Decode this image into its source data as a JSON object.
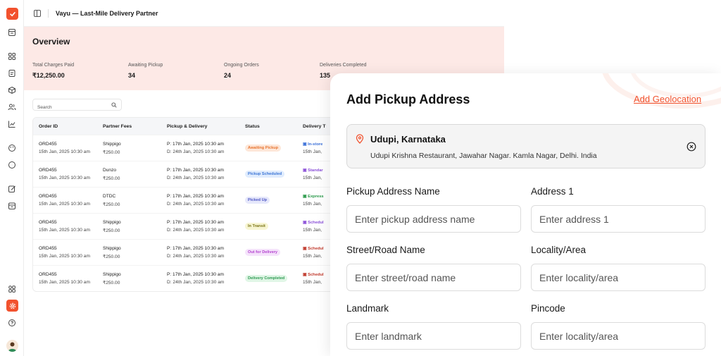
{
  "app": {
    "title": "Vayu — Last-Mile Delivery Partner"
  },
  "sidebar": {
    "icons": [
      "checklist-logo-icon",
      "orders-icon",
      "grid-icon",
      "document-icon",
      "box-icon",
      "users-icon",
      "chart-icon",
      "palette-icon",
      "chat-icon",
      "edit-icon",
      "archive-icon",
      "apps-icon",
      "settings-icon",
      "help-icon",
      "avatar"
    ]
  },
  "overview": {
    "title": "Overview",
    "stats": [
      {
        "label": "Total Charges Paid",
        "value": "₹12,250.00"
      },
      {
        "label": "Awaiting Pickup",
        "value": "34"
      },
      {
        "label": "Ongoing Orders",
        "value": "24"
      },
      {
        "label": "Deliveries Completed",
        "value": "135"
      }
    ]
  },
  "search": {
    "placeholder": "Search"
  },
  "table": {
    "headers": [
      "Order ID",
      "Partner Fees",
      "Pickup & Delivery",
      "Status",
      "Delivery T"
    ],
    "rows": [
      {
        "order_id": "ORD455",
        "order_date": "15th Jan, 2025 10:30 am",
        "partner": "Shippigo",
        "fee": "₹250.00",
        "pickup": "P: 17th Jan, 2025 10:30 am",
        "delivery": "D: 24th Jan, 2025 10:30 am",
        "status": "Awaiting Pickup",
        "status_bg": "#fde7d9",
        "status_fg": "#e8742f",
        "dtype": "In-store",
        "dtype_color": "#3a6fd8",
        "dtype_date": "15th Jan,"
      },
      {
        "order_id": "ORD455",
        "order_date": "15th Jan, 2025 10:30 am",
        "partner": "Dunzo",
        "fee": "₹250.00",
        "pickup": "P: 17th Jan, 2025 10:30 am",
        "delivery": "D: 24th Jan, 2025 10:30 am",
        "status": "Pickup Scheduled",
        "status_bg": "#e0ecfd",
        "status_fg": "#3a74d6",
        "dtype": "Standar",
        "dtype_color": "#8a4fd8",
        "dtype_date": "15th Jan,"
      },
      {
        "order_id": "ORD455",
        "order_date": "15th Jan, 2025 10:30 am",
        "partner": "DTDC",
        "fee": "₹250.00",
        "pickup": "P: 17th Jan, 2025 10:30 am",
        "delivery": "D: 24th Jan, 2025 10:30 am",
        "status": "Picked Up",
        "status_bg": "#e6e8fb",
        "status_fg": "#4b54c4",
        "dtype": "Express",
        "dtype_color": "#2a9a4a",
        "dtype_date": "15th Jan,"
      },
      {
        "order_id": "ORD455",
        "order_date": "15th Jan, 2025 10:30 am",
        "partner": "Shippigo",
        "fee": "₹250.00",
        "pickup": "P: 17th Jan, 2025 10:30 am",
        "delivery": "D: 24th Jan, 2025 10:30 am",
        "status": "In Transit",
        "status_bg": "#f7f5d2",
        "status_fg": "#7a7414",
        "dtype": "Schedul",
        "dtype_color": "#8a4fd8",
        "dtype_date": "15th Jan,"
      },
      {
        "order_id": "ORD455",
        "order_date": "15th Jan, 2025 10:30 am",
        "partner": "Shippigo",
        "fee": "₹250.00",
        "pickup": "P: 17th Jan, 2025 10:30 am",
        "delivery": "D: 24th Jan, 2025 10:30 am",
        "status": "Out for Delivery",
        "status_bg": "#f5e3fb",
        "status_fg": "#b340cf",
        "dtype": "Schedul",
        "dtype_color": "#c0392b",
        "dtype_date": "15th Jan,"
      },
      {
        "order_id": "ORD455",
        "order_date": "15th Jan, 2025 10:30 am",
        "partner": "Shippigo",
        "fee": "₹250.00",
        "pickup": "P: 17th Jan, 2025 10:30 am",
        "delivery": "D: 24th Jan, 2025 10:30 am",
        "status": "Delivery Completed",
        "status_bg": "#e0f6e6",
        "status_fg": "#2e9a52",
        "dtype": "Schedul",
        "dtype_color": "#c0392b",
        "dtype_date": "15th Jan,"
      }
    ]
  },
  "modal": {
    "title": "Add Pickup Address",
    "geo_link": "Add Geolocation",
    "selected_city": "Udupi, Karnataka",
    "selected_full": "Udupi Krishna Restaurant, Jawahar Nagar. Kamla Nagar, Delhi. India",
    "fields": [
      {
        "label": "Pickup Address Name",
        "placeholder": "Enter pickup address name"
      },
      {
        "label": "Address 1",
        "placeholder": "Enter address 1"
      },
      {
        "label": "Street/Road Name",
        "placeholder": "Enter street/road name"
      },
      {
        "label": "Locality/Area",
        "placeholder": "Enter locality/area"
      },
      {
        "label": "Landmark",
        "placeholder": "Enter landmark"
      },
      {
        "label": "Pincode",
        "placeholder": "Enter locality/area"
      }
    ]
  },
  "colors": {
    "accent": "#f2522e",
    "overview_bg": "#fde9e6"
  }
}
